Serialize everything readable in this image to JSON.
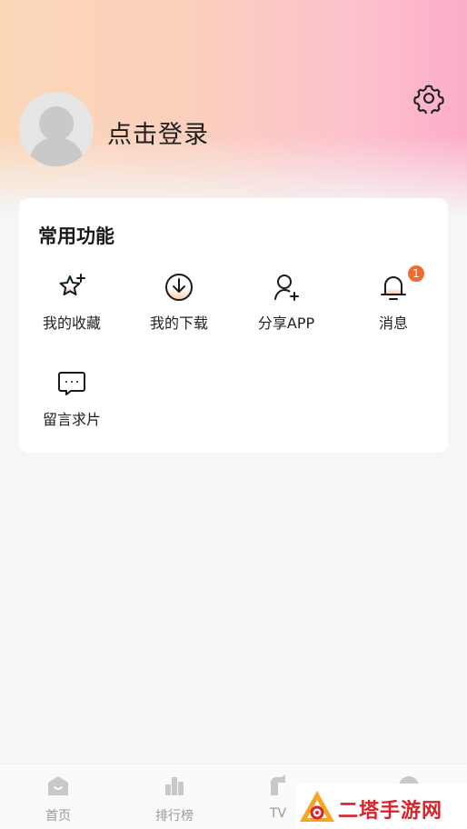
{
  "profile": {
    "login_label": "点击登录"
  },
  "common": {
    "title": "常用功能",
    "items": [
      {
        "label": "我的收藏",
        "icon": "star-plus-icon"
      },
      {
        "label": "我的下载",
        "icon": "download-icon"
      },
      {
        "label": "分享APP",
        "icon": "add-user-icon"
      },
      {
        "label": "消息",
        "icon": "bell-icon",
        "badge": "1"
      },
      {
        "label": "留言求片",
        "icon": "chat-bubble-icon"
      }
    ]
  },
  "tabbar": {
    "tabs": [
      {
        "label": "首页",
        "icon": "home-icon"
      },
      {
        "label": "排行榜",
        "icon": "ranking-icon"
      },
      {
        "label": "TV",
        "icon": "tv-icon"
      },
      {
        "label": "",
        "icon": "profile-icon"
      }
    ]
  },
  "watermark": {
    "text": "二塔手游网"
  },
  "colors": {
    "accent": "#f26a2e",
    "badge": "#f26a2e",
    "watermark": "#d8232a"
  }
}
